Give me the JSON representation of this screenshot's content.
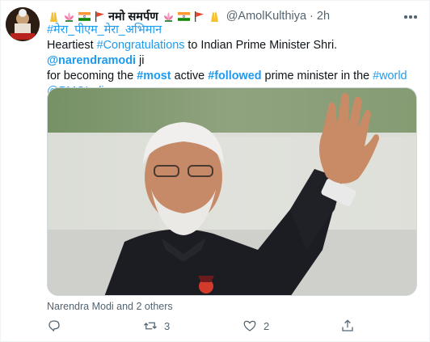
{
  "tweet": {
    "display_name": "नमो समर्पण",
    "handle": "@AmolKulthiya",
    "separator": "·",
    "time": "2h",
    "lines": {
      "l1_pre": "Heartiest ",
      "l1_tag": "#Congratulations",
      "l1_mid": " to Indian Prime Minister Shri. ",
      "l1_mention": "@narendramodi",
      "l1_end": " ji",
      "l2_pre": "for becoming the ",
      "l2_tag1": "#most",
      "l2_mid1": " active ",
      "l2_tag2": "#followed",
      "l2_mid2": " prime minister in the ",
      "l2_tag3": "#world",
      "l3_mention": "@PMOIndia",
      "l0_tag": "#मेरा_पीएम_मेरा_अभिमान"
    },
    "tagged": "Narendra Modi and 2 others",
    "actions": {
      "reply_count": "",
      "retweet_count": "3",
      "like_count": "2"
    }
  },
  "colors": {
    "link": "#1d9bf0",
    "secondary": "#536471"
  },
  "icons": [
    "folded-hands-emoji",
    "lotus-emoji",
    "india-flag-emoji",
    "saffron-flag-emoji",
    "more-icon",
    "reply-icon",
    "retweet-icon",
    "like-icon",
    "share-icon",
    "person-tag-icon"
  ]
}
